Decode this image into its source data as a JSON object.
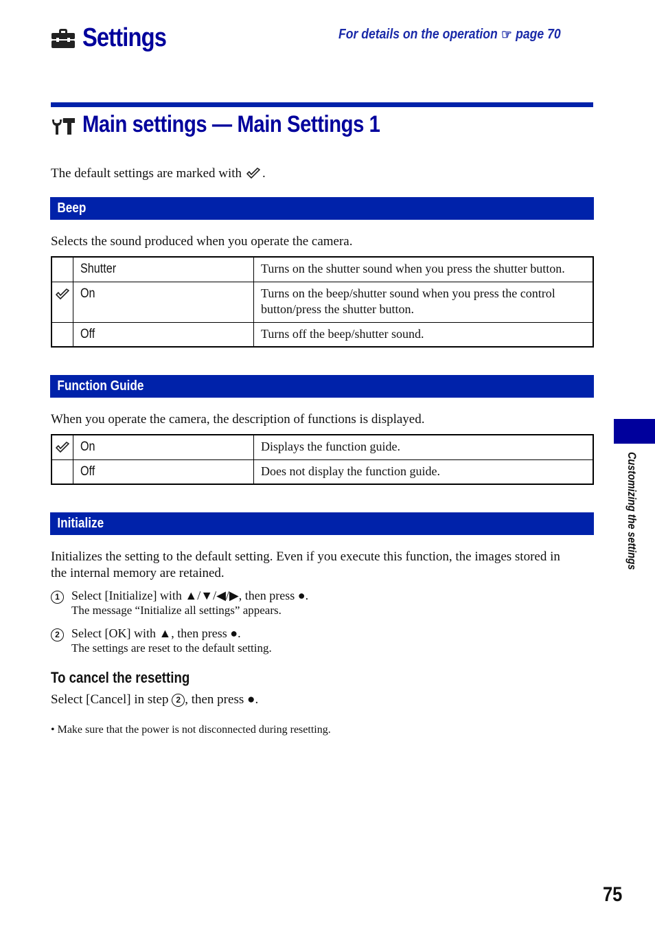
{
  "header": {
    "title": "Settings",
    "title_icon": "toolbox-icon",
    "reference_prefix": "For details on the operation",
    "reference_icon": "pointing-hand-icon",
    "reference_page": "page 70"
  },
  "section": {
    "icon": "wrench-hammer-icon",
    "heading": "Main settings — Main Settings 1",
    "default_note_prefix": "The default settings are marked with",
    "default_note_suffix": "."
  },
  "beep": {
    "title": "Beep",
    "description": "Selects the sound produced when you operate the camera.",
    "rows": [
      {
        "default": false,
        "name": "Shutter",
        "desc": "Turns on the shutter sound when you press the shutter button."
      },
      {
        "default": true,
        "name": "On",
        "desc": "Turns on the beep/shutter sound when you press the control button/press the shutter button."
      },
      {
        "default": false,
        "name": "Off",
        "desc": "Turns off the beep/shutter sound."
      }
    ]
  },
  "function_guide": {
    "title": "Function Guide",
    "description": "When you operate the camera, the description of functions is displayed.",
    "rows": [
      {
        "default": true,
        "name": "On",
        "desc": "Displays the function guide."
      },
      {
        "default": false,
        "name": "Off",
        "desc": "Does not display the function guide."
      }
    ]
  },
  "initialize": {
    "title": "Initialize",
    "description": "Initializes the setting to the default setting. Even if you execute this function, the images stored in the internal memory are retained.",
    "steps": [
      {
        "number": "1",
        "text": "Select [Initialize] with ▲/▼/◀/▶, then press ●.",
        "sub": "The message “Initialize all settings” appears."
      },
      {
        "number": "2",
        "text": "Select [OK] with ▲, then press ●.",
        "sub": "The settings are reset to the default setting."
      }
    ],
    "cancel_heading": "To cancel the resetting",
    "cancel_text_prefix": "Select [Cancel] in step",
    "cancel_step": "2",
    "cancel_text_suffix": ", then press ●.",
    "note": "• Make sure that the power is not disconnected during resetting."
  },
  "side_tab": {
    "label": "Customizing the settings",
    "color": "#00009c"
  },
  "page_number": "75",
  "colors": {
    "title_blue": "#00009c",
    "bar_blue": "#0022aa",
    "link_blue": "#1a2aa8"
  }
}
